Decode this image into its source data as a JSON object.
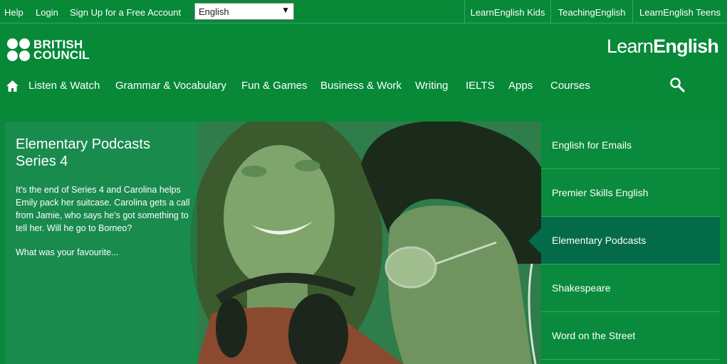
{
  "topbar": {
    "help": "Help",
    "login": "Login",
    "signup": "Sign Up for a Free Account",
    "language": "English",
    "sites": [
      "LearnEnglish Kids",
      "TeachingEnglish",
      "LearnEnglish Teens"
    ]
  },
  "logos": {
    "british_council_line1": "BRITISH",
    "british_council_line2": "COUNCIL",
    "learn": "Learn",
    "english": "English"
  },
  "nav": {
    "items": [
      "Listen & Watch",
      "Grammar & Vocabulary",
      "Fun & Games",
      "Business & Work",
      "Writing",
      "IELTS",
      "Apps",
      "Courses"
    ]
  },
  "hero": {
    "title": "Elementary Podcasts Series 4",
    "description": "It's the end of Series 4 and Carolina helps Emily pack her suitcase. Carolina gets a call from Jamie, who says he's got something to tell her. Will he go to Borneo?",
    "more": "What was your favourite..."
  },
  "side_menu": {
    "items": [
      "English for Emails",
      "Premier Skills English",
      "Elementary Podcasts",
      "Shakespeare",
      "Word on the Street"
    ],
    "active": "Elementary Podcasts"
  },
  "colors": {
    "brand_green": "#078938",
    "active_item": "#046b48",
    "divider": "#3aa663"
  }
}
